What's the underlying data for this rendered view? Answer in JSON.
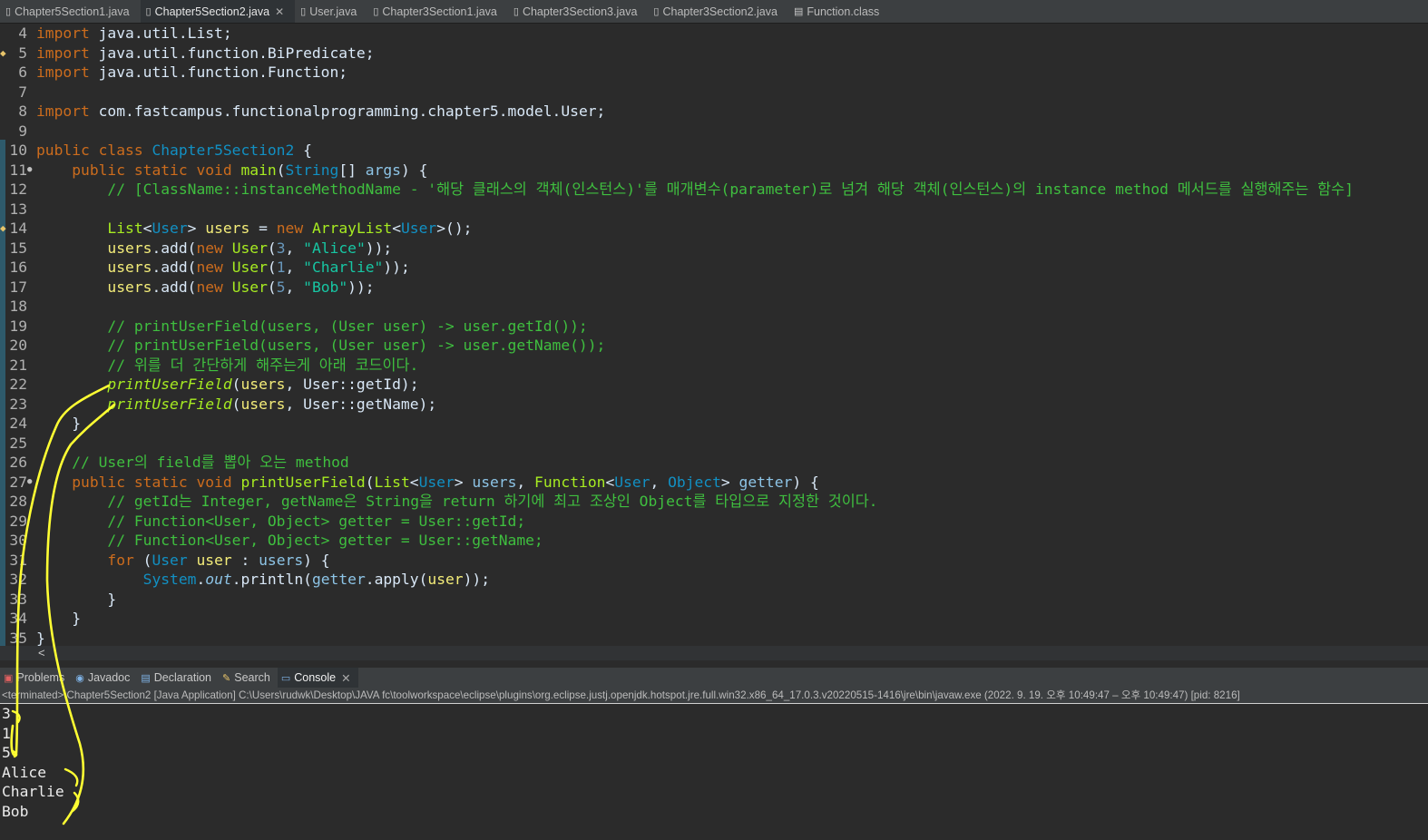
{
  "tabs": [
    {
      "label": "Chapter5Section1.java",
      "active": false,
      "icon": "java-file-icon"
    },
    {
      "label": "Chapter5Section2.java",
      "active": true,
      "icon": "java-file-icon"
    },
    {
      "label": "User.java",
      "active": false,
      "icon": "java-file-icon"
    },
    {
      "label": "Chapter3Section1.java",
      "active": false,
      "icon": "java-file-icon"
    },
    {
      "label": "Chapter3Section3.java",
      "active": false,
      "icon": "java-file-icon"
    },
    {
      "label": "Chapter3Section2.java",
      "active": false,
      "icon": "java-file-icon"
    },
    {
      "label": "Function.class",
      "active": false,
      "icon": "class-file-icon"
    }
  ],
  "lines": [
    {
      "n": "4",
      "html": "<span class='kw'>import</span> java.util.List;"
    },
    {
      "n": "5",
      "html": "<span class='kw'>import</span> java.util.function.BiPredicate;"
    },
    {
      "n": "6",
      "html": "<span class='kw'>import</span> java.util.function.Function;"
    },
    {
      "n": "7",
      "html": ""
    },
    {
      "n": "8",
      "html": "<span class='kw'>import</span> com.fastcampus.functionalprogramming.chapter5.model.User;"
    },
    {
      "n": "9",
      "html": ""
    },
    {
      "n": "10",
      "html": "<span class='kw'>public class</span> <span class='cls'>Chapter5Section2</span> {"
    },
    {
      "n": "11",
      "html": "    <span class='kw'>public static void</span> <span class='fn'>main</span>(<span class='cls'>String</span>[] <span class='fld'>args</span>) {"
    },
    {
      "n": "12",
      "html": "        <span class='cmt'>// [ClassName::instanceMethodName - '해당 클래스의 객체(인스턴스)'를 매개변수(parameter)로 넘겨 해당 객체(인스턴스)의 instance method 메서드를 실행해주는 함수]</span>"
    },
    {
      "n": "13",
      "html": ""
    },
    {
      "n": "14",
      "html": "        <span class='fn'>List</span>&lt;<span class='cls'>User</span>&gt; <span class='var'>users</span> = <span class='kw'>new</span> <span class='fn'>ArrayList</span>&lt;<span class='cls'>User</span>&gt;();"
    },
    {
      "n": "15",
      "html": "        <span class='var'>users</span>.add(<span class='kw'>new</span> <span class='fn'>User</span>(<span class='num'>3</span>, <span class='str'>\"Alice\"</span>));"
    },
    {
      "n": "16",
      "html": "        <span class='var'>users</span>.add(<span class='kw'>new</span> <span class='fn'>User</span>(<span class='num'>1</span>, <span class='str'>\"Charlie\"</span>));"
    },
    {
      "n": "17",
      "html": "        <span class='var'>users</span>.add(<span class='kw'>new</span> <span class='fn'>User</span>(<span class='num'>5</span>, <span class='str'>\"Bob\"</span>));"
    },
    {
      "n": "18",
      "html": ""
    },
    {
      "n": "19",
      "html": "        <span class='cmt'>// printUserField(users, (User user) -&gt; user.getId());</span>"
    },
    {
      "n": "20",
      "html": "        <span class='cmt'>// printUserField(users, (User user) -&gt; user.getName());</span>"
    },
    {
      "n": "21",
      "html": "        <span class='cmt'>// 위를 더 간단하게 해주는게 아래 코드이다.</span>"
    },
    {
      "n": "22",
      "html": "        <span class='fn it'>printUserField</span>(<span class='var'>users</span>, User::getId);"
    },
    {
      "n": "23",
      "html": "        <span class='fn it'>printUserField</span>(<span class='var'>users</span>, User::getName);"
    },
    {
      "n": "24",
      "html": "    }"
    },
    {
      "n": "25",
      "html": ""
    },
    {
      "n": "26",
      "html": "    <span class='cmt'>// User의 field를 뽑아 오는 method</span>"
    },
    {
      "n": "27",
      "html": "    <span class='kw'>public static void</span> <span class='fn'>printUserField</span>(<span class='fn'>List</span>&lt;<span class='cls'>User</span>&gt; <span class='fld'>users</span>, <span class='fn'>Function</span>&lt;<span class='cls'>User</span>, <span class='cls'>Object</span>&gt; <span class='fld'>getter</span>) {"
    },
    {
      "n": "28",
      "html": "        <span class='cmt'>// getId는 Integer, getName은 String을 return 하기에 최고 조상인 Object를 타입으로 지정한 것이다.</span>"
    },
    {
      "n": "29",
      "html": "        <span class='cmt'>// Function&lt;User, Object&gt; getter = User::getId;</span>"
    },
    {
      "n": "30",
      "html": "        <span class='cmt'>// Function&lt;User, Object&gt; getter = User::getName;</span>"
    },
    {
      "n": "31",
      "html": "        <span class='kw'>for</span> (<span class='cls'>User</span> <span class='var'>user</span> : <span class='fld'>users</span>) {"
    },
    {
      "n": "32",
      "html": "            <span class='cls'>System</span>.<span class='fld it'>out</span>.println(<span class='fld'>getter</span>.apply(<span class='var'>user</span>));"
    },
    {
      "n": "33",
      "html": "        }"
    },
    {
      "n": "34",
      "html": "    }"
    },
    {
      "n": "35",
      "html": "}"
    }
  ],
  "panel_tabs": [
    {
      "label": "Problems",
      "icon": "problems-icon",
      "active": false
    },
    {
      "label": "Javadoc",
      "icon": "javadoc-icon",
      "active": false
    },
    {
      "label": "Declaration",
      "icon": "declaration-icon",
      "active": false
    },
    {
      "label": "Search",
      "icon": "search-icon",
      "active": false
    },
    {
      "label": "Console",
      "icon": "console-icon",
      "active": true
    }
  ],
  "console": {
    "header": "<terminated> Chapter5Section2 [Java Application] C:\\Users\\rudwk\\Desktop\\JAVA fc\\toolworkspace\\eclipse\\plugins\\org.eclipse.justj.openjdk.hotspot.jre.full.win32.x86_64_17.0.3.v20220515-1416\\jre\\bin\\javaw.exe  (2022. 9. 19. 오후 10:49:47 – 오후 10:49:47) [pid: 8216]",
    "output": [
      "3",
      "1",
      "5",
      "Alice",
      "Charlie",
      "Bob"
    ]
  },
  "scroll_arrow": "<",
  "colors": {
    "background": "#2b2b2b",
    "annotation": "#ffff33"
  }
}
